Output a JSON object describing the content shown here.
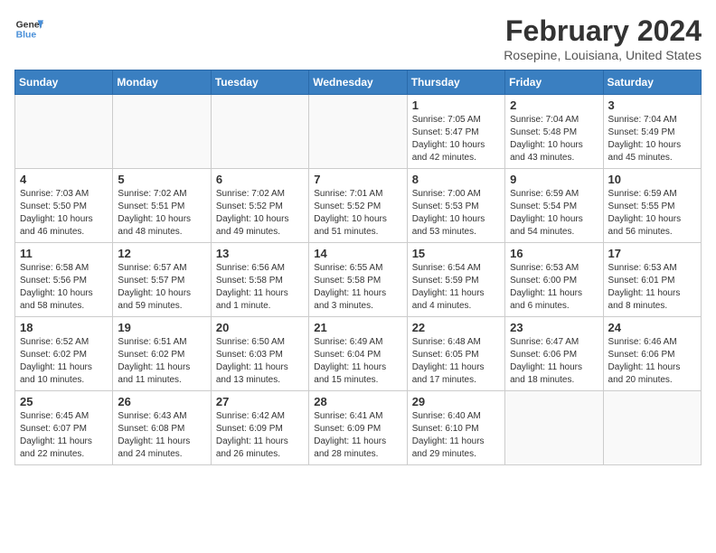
{
  "header": {
    "logo_line1": "General",
    "logo_line2": "Blue",
    "month_year": "February 2024",
    "location": "Rosepine, Louisiana, United States"
  },
  "days_of_week": [
    "Sunday",
    "Monday",
    "Tuesday",
    "Wednesday",
    "Thursday",
    "Friday",
    "Saturday"
  ],
  "weeks": [
    [
      {
        "day": "",
        "info": ""
      },
      {
        "day": "",
        "info": ""
      },
      {
        "day": "",
        "info": ""
      },
      {
        "day": "",
        "info": ""
      },
      {
        "day": "1",
        "info": "Sunrise: 7:05 AM\nSunset: 5:47 PM\nDaylight: 10 hours\nand 42 minutes."
      },
      {
        "day": "2",
        "info": "Sunrise: 7:04 AM\nSunset: 5:48 PM\nDaylight: 10 hours\nand 43 minutes."
      },
      {
        "day": "3",
        "info": "Sunrise: 7:04 AM\nSunset: 5:49 PM\nDaylight: 10 hours\nand 45 minutes."
      }
    ],
    [
      {
        "day": "4",
        "info": "Sunrise: 7:03 AM\nSunset: 5:50 PM\nDaylight: 10 hours\nand 46 minutes."
      },
      {
        "day": "5",
        "info": "Sunrise: 7:02 AM\nSunset: 5:51 PM\nDaylight: 10 hours\nand 48 minutes."
      },
      {
        "day": "6",
        "info": "Sunrise: 7:02 AM\nSunset: 5:52 PM\nDaylight: 10 hours\nand 49 minutes."
      },
      {
        "day": "7",
        "info": "Sunrise: 7:01 AM\nSunset: 5:52 PM\nDaylight: 10 hours\nand 51 minutes."
      },
      {
        "day": "8",
        "info": "Sunrise: 7:00 AM\nSunset: 5:53 PM\nDaylight: 10 hours\nand 53 minutes."
      },
      {
        "day": "9",
        "info": "Sunrise: 6:59 AM\nSunset: 5:54 PM\nDaylight: 10 hours\nand 54 minutes."
      },
      {
        "day": "10",
        "info": "Sunrise: 6:59 AM\nSunset: 5:55 PM\nDaylight: 10 hours\nand 56 minutes."
      }
    ],
    [
      {
        "day": "11",
        "info": "Sunrise: 6:58 AM\nSunset: 5:56 PM\nDaylight: 10 hours\nand 58 minutes."
      },
      {
        "day": "12",
        "info": "Sunrise: 6:57 AM\nSunset: 5:57 PM\nDaylight: 10 hours\nand 59 minutes."
      },
      {
        "day": "13",
        "info": "Sunrise: 6:56 AM\nSunset: 5:58 PM\nDaylight: 11 hours\nand 1 minute."
      },
      {
        "day": "14",
        "info": "Sunrise: 6:55 AM\nSunset: 5:58 PM\nDaylight: 11 hours\nand 3 minutes."
      },
      {
        "day": "15",
        "info": "Sunrise: 6:54 AM\nSunset: 5:59 PM\nDaylight: 11 hours\nand 4 minutes."
      },
      {
        "day": "16",
        "info": "Sunrise: 6:53 AM\nSunset: 6:00 PM\nDaylight: 11 hours\nand 6 minutes."
      },
      {
        "day": "17",
        "info": "Sunrise: 6:53 AM\nSunset: 6:01 PM\nDaylight: 11 hours\nand 8 minutes."
      }
    ],
    [
      {
        "day": "18",
        "info": "Sunrise: 6:52 AM\nSunset: 6:02 PM\nDaylight: 11 hours\nand 10 minutes."
      },
      {
        "day": "19",
        "info": "Sunrise: 6:51 AM\nSunset: 6:02 PM\nDaylight: 11 hours\nand 11 minutes."
      },
      {
        "day": "20",
        "info": "Sunrise: 6:50 AM\nSunset: 6:03 PM\nDaylight: 11 hours\nand 13 minutes."
      },
      {
        "day": "21",
        "info": "Sunrise: 6:49 AM\nSunset: 6:04 PM\nDaylight: 11 hours\nand 15 minutes."
      },
      {
        "day": "22",
        "info": "Sunrise: 6:48 AM\nSunset: 6:05 PM\nDaylight: 11 hours\nand 17 minutes."
      },
      {
        "day": "23",
        "info": "Sunrise: 6:47 AM\nSunset: 6:06 PM\nDaylight: 11 hours\nand 18 minutes."
      },
      {
        "day": "24",
        "info": "Sunrise: 6:46 AM\nSunset: 6:06 PM\nDaylight: 11 hours\nand 20 minutes."
      }
    ],
    [
      {
        "day": "25",
        "info": "Sunrise: 6:45 AM\nSunset: 6:07 PM\nDaylight: 11 hours\nand 22 minutes."
      },
      {
        "day": "26",
        "info": "Sunrise: 6:43 AM\nSunset: 6:08 PM\nDaylight: 11 hours\nand 24 minutes."
      },
      {
        "day": "27",
        "info": "Sunrise: 6:42 AM\nSunset: 6:09 PM\nDaylight: 11 hours\nand 26 minutes."
      },
      {
        "day": "28",
        "info": "Sunrise: 6:41 AM\nSunset: 6:09 PM\nDaylight: 11 hours\nand 28 minutes."
      },
      {
        "day": "29",
        "info": "Sunrise: 6:40 AM\nSunset: 6:10 PM\nDaylight: 11 hours\nand 29 minutes."
      },
      {
        "day": "",
        "info": ""
      },
      {
        "day": "",
        "info": ""
      }
    ]
  ]
}
